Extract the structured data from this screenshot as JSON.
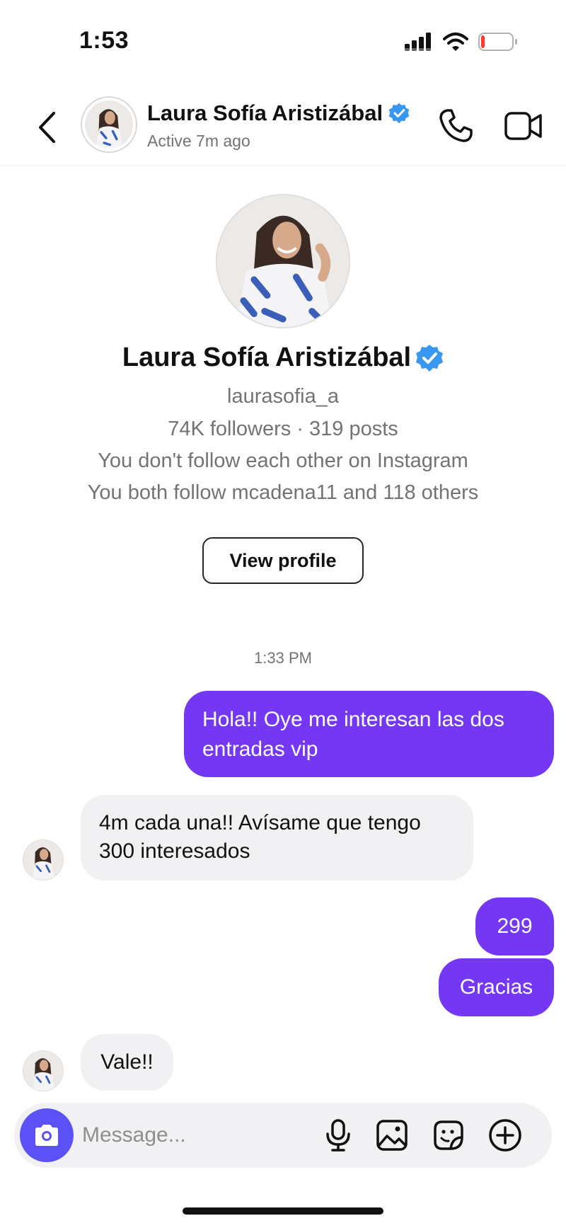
{
  "status_bar": {
    "time": "1:53",
    "signal_icon": "cellular-signal-icon",
    "wifi_icon": "wifi-icon",
    "battery_icon": "battery-low-icon",
    "battery_level": 0.12,
    "battery_color": "#ff3b30"
  },
  "header": {
    "back_icon": "chevron-left-icon",
    "name": "Laura Sofía Aristizábal",
    "verified": true,
    "status": "Active 7m ago",
    "call_icon": "phone-icon",
    "video_icon": "video-camera-icon"
  },
  "profile": {
    "name": "Laura Sofía Aristizábal",
    "verified": true,
    "username": "laurasofia_a",
    "stats": "74K followers · 319 posts",
    "follow_status": "You don't follow each other on Instagram",
    "mutuals": "You both follow mcadena11 and 118 others",
    "view_profile_label": "View profile"
  },
  "conversation": {
    "timestamp": "1:33 PM",
    "messages": [
      {
        "direction": "outgoing",
        "text": "Hola!! Oye me interesan las dos entradas vip"
      },
      {
        "direction": "incoming",
        "text": "4m cada una!! Avísame que tengo 300 interesados"
      },
      {
        "direction": "outgoing",
        "text": "299"
      },
      {
        "direction": "outgoing",
        "text": "Gracias"
      },
      {
        "direction": "incoming",
        "text": "Vale!!"
      }
    ]
  },
  "composer": {
    "placeholder": "Message...",
    "camera_icon": "camera-icon",
    "mic_icon": "microphone-icon",
    "gallery_icon": "image-icon",
    "sticker_icon": "sticker-icon",
    "plus_icon": "plus-circle-icon"
  },
  "colors": {
    "outgoing_bubble": "#7438f5",
    "incoming_bubble": "#f1f1f3",
    "camera_button": "#5b51f7",
    "verified_badge": "#3897f0",
    "secondary_text": "#737373"
  }
}
